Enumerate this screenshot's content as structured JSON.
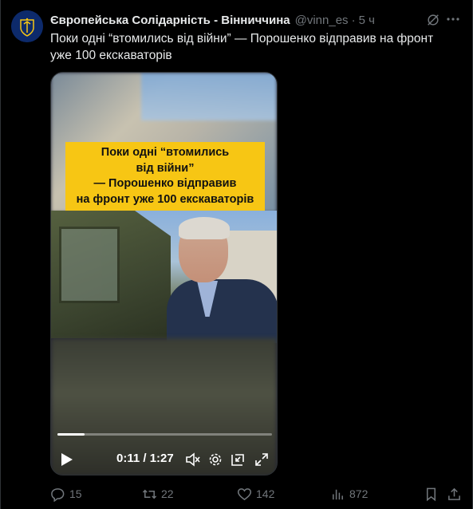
{
  "tweet": {
    "author_name": "Європейська Солідарність - Вінниччина",
    "handle": "@vinn_es",
    "separator": "·",
    "time": "5 ч",
    "text": "Поки одні “втомились від війни” — Порошенко відправив на фронт уже 100 екскаваторів"
  },
  "video": {
    "caption_lines": [
      "Поки одні “втомились",
      "від війни”",
      "— Порошенко відправив",
      "на фронт уже 100 екскаваторів"
    ],
    "current_time": "0:11",
    "time_separator": "/",
    "duration": "1:27",
    "progress_fraction": 0.126
  },
  "actions": {
    "replies": "15",
    "reposts": "22",
    "likes": "142",
    "views": "872"
  },
  "colors": {
    "caption_bg": "#f7c614",
    "muted": "#71767b",
    "text": "#e7e9ea"
  }
}
